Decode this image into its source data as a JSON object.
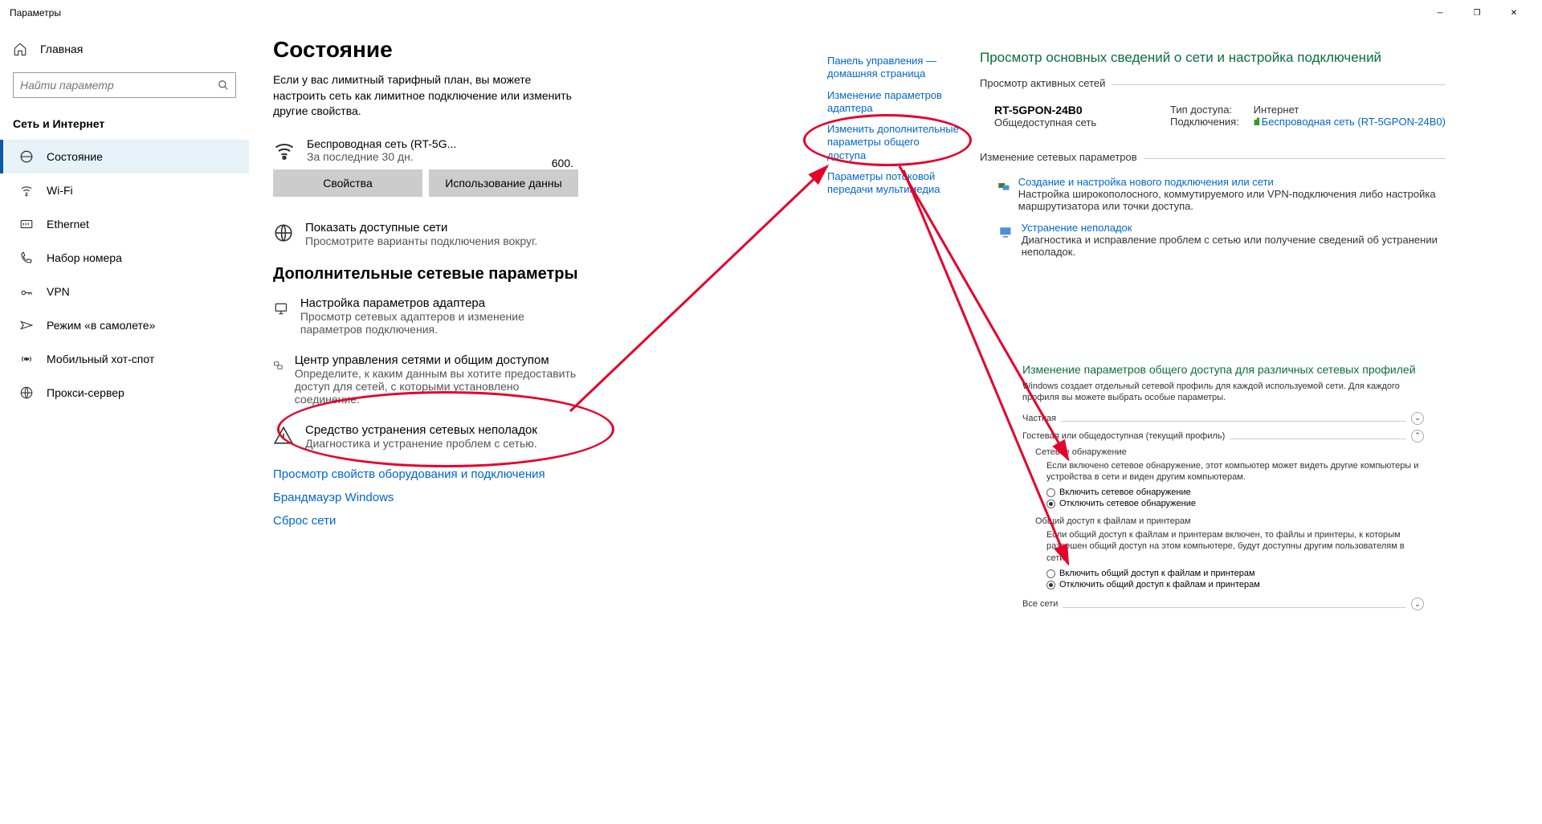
{
  "titlebar": {
    "title": "Параметры"
  },
  "sidebar": {
    "home": "Главная",
    "search_placeholder": "Найти параметр",
    "section": "Сеть и Интернет",
    "items": [
      {
        "label": "Состояние"
      },
      {
        "label": "Wi-Fi"
      },
      {
        "label": "Ethernet"
      },
      {
        "label": "Набор номера"
      },
      {
        "label": "VPN"
      },
      {
        "label": "Режим «в самолете»"
      },
      {
        "label": "Мобильный хот-спот"
      },
      {
        "label": "Прокси-сервер"
      }
    ]
  },
  "status": {
    "title": "Состояние",
    "desc": "Если у вас лимитный тарифный план, вы можете настроить сеть как лимитное подключение или изменить другие свойства.",
    "wifi_name": "Беспроводная сеть (RT-5G...",
    "wifi_sub": "За последние 30 дн.",
    "wifi_num": "600.",
    "btn_props": "Свойства",
    "btn_usage": "Использование данны",
    "show_nets": {
      "title": "Показать доступные сети",
      "desc": "Просмотрите варианты подключения вокруг."
    },
    "adv_header": "Дополнительные сетевые параметры",
    "adapter": {
      "title": "Настройка параметров адаптера",
      "desc": "Просмотр сетевых адаптеров и изменение параметров подключения."
    },
    "center": {
      "title": "Центр управления сетями и общим доступом",
      "desc": "Определите, к каким данным вы хотите предоставить доступ для сетей, с которыми установлено соединение."
    },
    "troubleshoot": {
      "title": "Средство устранения сетевых неполадок",
      "desc": "Диагностика и устранение проблем с сетью."
    },
    "link_hw": "Просмотр свойств оборудования и подключения",
    "link_fw": "Брандмауэр Windows",
    "link_reset": "Сброс сети"
  },
  "cp_links": {
    "home": "Панель управления — домашняя страница",
    "adapter": "Изменение параметров адаптера",
    "sharing": "Изменить дополнительные параметры общего доступа",
    "media": "Параметры потоковой передачи мультимедиа"
  },
  "netcenter": {
    "title": "Просмотр основных сведений о сети и настройка подключений",
    "active_label": "Просмотр активных сетей",
    "net_name": "RT-5GPON-24B0",
    "net_type": "Общедоступная сеть",
    "access_label": "Тип доступа:",
    "access_val": "Интернет",
    "conn_label": "Подключения:",
    "conn_val": "Беспроводная сеть (RT-5GPON-24B0)",
    "change_label": "Изменение сетевых параметров",
    "new_conn": {
      "title": "Создание и настройка нового подключения или сети",
      "desc": "Настройка широкополосного, коммутируемого или VPN-подключения либо настройка маршрутизатора или точки доступа."
    },
    "troubleshoot": {
      "title": "Устранение неполадок",
      "desc": "Диагностика и исправление проблем с сетью или получение сведений об устранении неполадок."
    }
  },
  "adv": {
    "title": "Изменение параметров общего доступа для различных сетевых профилей",
    "sub": "Windows создает отдельный сетевой профиль для каждой используемой сети. Для каждого профиля вы можете выбрать особые параметры.",
    "private": "Частная",
    "guest": "Гостевая или общедоступная (текущий профиль)",
    "discovery": {
      "title": "Сетевое обнаружение",
      "desc": "Если включено сетевое обнаружение, этот компьютер может видеть другие компьютеры и устройства в сети и виден другим компьютерам.",
      "on": "Включить сетевое обнаружение",
      "off": "Отключить сетевое обнаружение"
    },
    "filesharing": {
      "title": "Общий доступ к файлам и принтерам",
      "desc": "Если общий доступ к файлам и принтерам включен, то файлы и принтеры, к которым разрешен общий доступ на этом компьютере, будут доступны другим пользователям в сети.",
      "on": "Включить общий доступ к файлам и принтерам",
      "off": "Отключить общий доступ к файлам и принтерам"
    },
    "allnets": "Все сети"
  }
}
